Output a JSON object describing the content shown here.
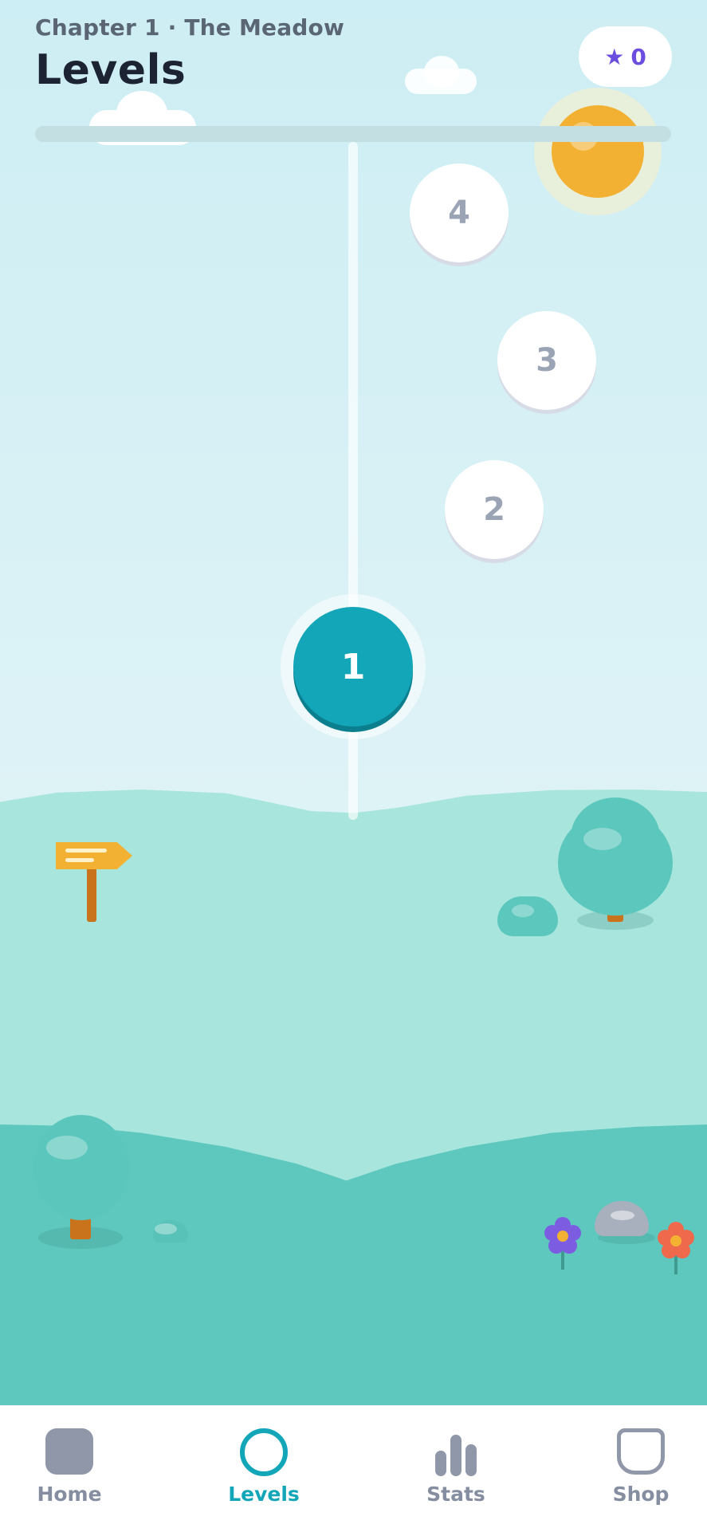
{
  "header": {
    "chapter": "Chapter 1 · The Meadow",
    "title": "Levels",
    "stars": {
      "icon": "star-icon",
      "symbol": "★",
      "count": "0"
    },
    "chapter_progress": 0
  },
  "levels": [
    {
      "number": "1",
      "state": "current"
    },
    {
      "number": "2",
      "state": "locked"
    },
    {
      "number": "3",
      "state": "locked"
    },
    {
      "number": "4",
      "state": "locked"
    }
  ],
  "nav": {
    "items": [
      {
        "label": "Home",
        "icon": "home-icon",
        "active": false
      },
      {
        "label": "Levels",
        "icon": "levels-icon",
        "active": true
      },
      {
        "label": "Stats",
        "icon": "stats-icon",
        "active": false
      },
      {
        "label": "Shop",
        "icon": "shop-icon",
        "active": false
      }
    ]
  },
  "colors": {
    "accent": "#12a6b8",
    "star": "#6b4de0",
    "sun": "#f2b133",
    "ground_light": "#a8e6dd",
    "ground_dark": "#5ec8bf",
    "nav_inactive": "#858ea0"
  }
}
